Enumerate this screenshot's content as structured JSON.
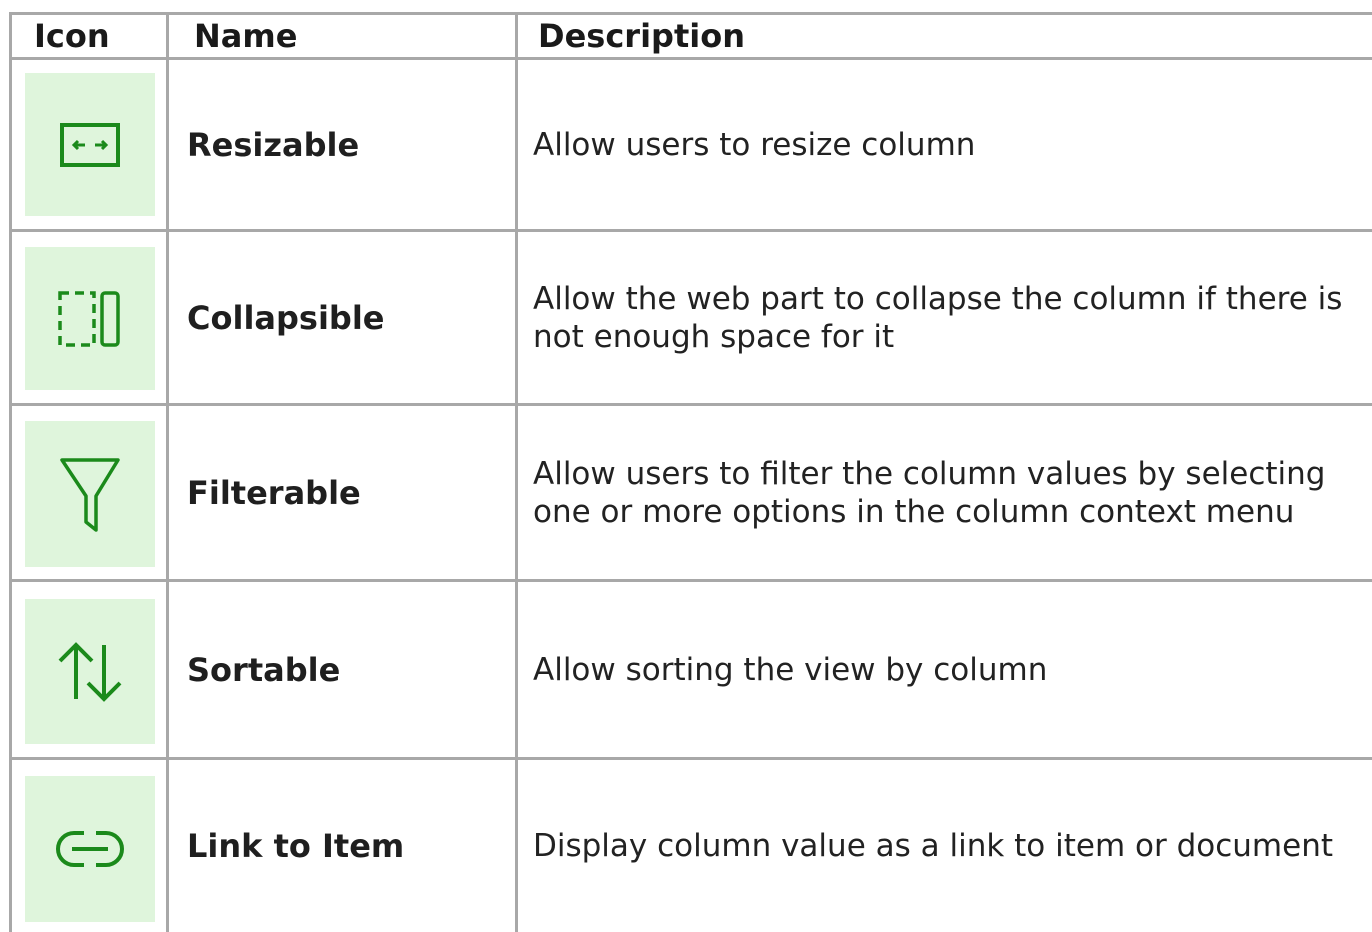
{
  "header": {
    "icon_col": "Icon",
    "name_col": "Name",
    "desc_col": "Description"
  },
  "rows": [
    {
      "icon": "resize-icon",
      "name": "Resizable",
      "description": "Allow users to resize column"
    },
    {
      "icon": "collapse-column-icon",
      "name": "Collapsible",
      "description": "Allow the web part to collapse the column if there is not enough space for it"
    },
    {
      "icon": "filter-funnel-icon",
      "name": "Filterable",
      "description": "Allow users to filter the column values by selecting one or more options in the column context menu"
    },
    {
      "icon": "sort-arrows-icon",
      "name": "Sortable",
      "description": "Allow sorting the view by column"
    },
    {
      "icon": "link-icon",
      "name": "Link to Item",
      "description": "Display column value as a link to item or document"
    }
  ],
  "colors": {
    "icon_background": "#dff5dc",
    "icon_stroke": "#1b8a1b",
    "grid_line": "#a8a8a8"
  }
}
